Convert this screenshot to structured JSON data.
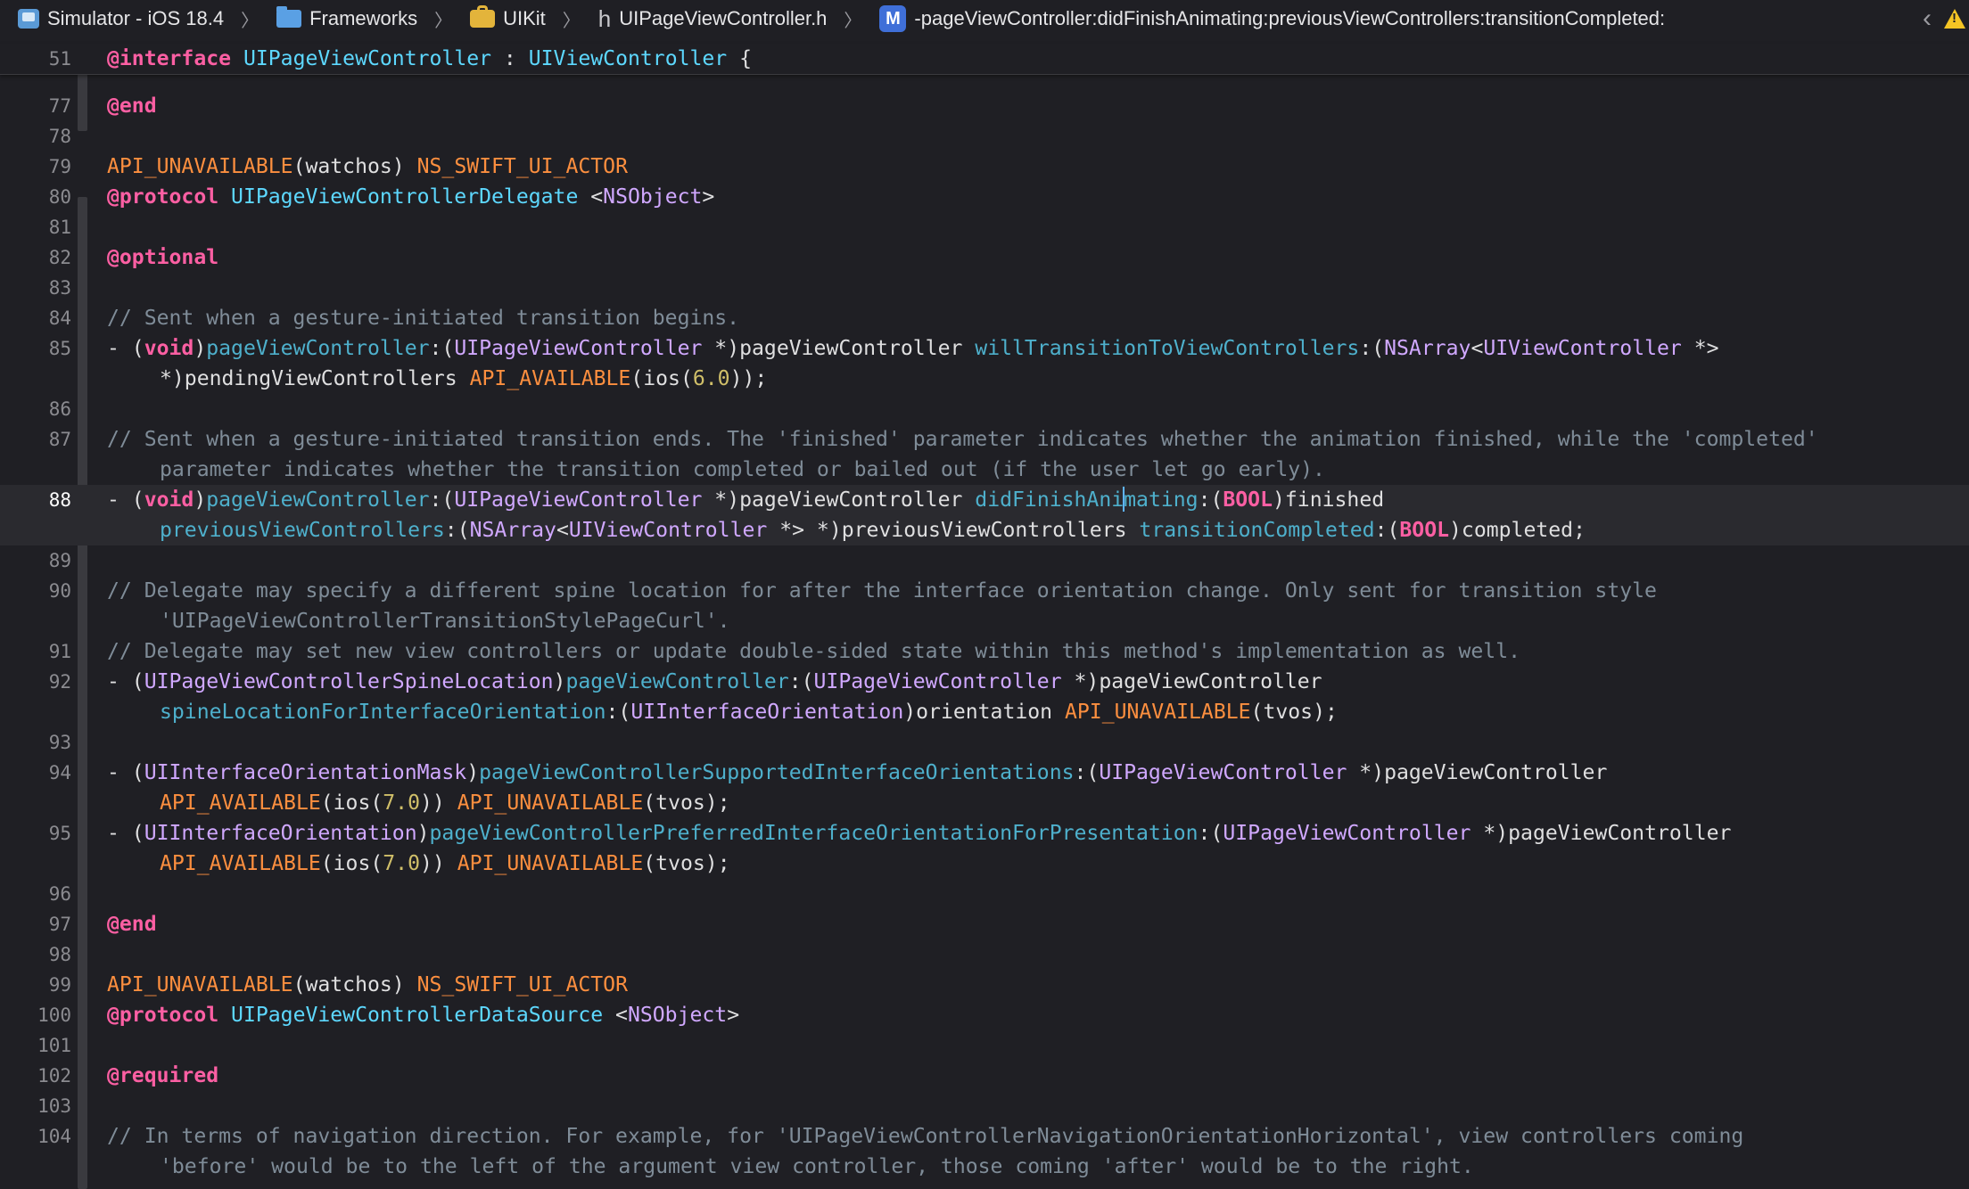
{
  "jumpbar": {
    "crumbs": [
      {
        "icon": "simulator-icon",
        "label": "Simulator - iOS 18.4"
      },
      {
        "icon": "folder-icon",
        "label": "Frameworks"
      },
      {
        "icon": "toolbox-icon",
        "label": "UIKit"
      },
      {
        "icon": "header-file-icon",
        "label": "UIPageViewController.h"
      },
      {
        "icon": "method-icon",
        "label": "-pageViewController:didFinishAnimating:previousViewControllers:transitionCompleted:"
      }
    ],
    "header_glyph": "h",
    "method_glyph": "M",
    "back_glyph": "‹",
    "warning_color": "#f5c424"
  },
  "sticky": {
    "number": "51",
    "code": "@interface UIPageViewController : UIViewController {"
  },
  "lines": [
    {
      "number": "77",
      "code": "@end"
    },
    {
      "number": "78",
      "code": ""
    },
    {
      "number": "79",
      "code": "API_UNAVAILABLE(watchos) NS_SWIFT_UI_ACTOR"
    },
    {
      "number": "80",
      "code": "@protocol UIPageViewControllerDelegate <NSObject>"
    },
    {
      "number": "81",
      "code": ""
    },
    {
      "number": "82",
      "code": "@optional"
    },
    {
      "number": "83",
      "code": ""
    },
    {
      "number": "84",
      "code": "// Sent when a gesture-initiated transition begins."
    },
    {
      "number": "85",
      "code": "- (void)pageViewController:(UIPageViewController *)pageViewController willTransitionToViewControllers:(NSArray<UIViewController *>",
      "cont": "*)pendingViewControllers API_AVAILABLE(ios(6.0));"
    },
    {
      "number": "86",
      "code": ""
    },
    {
      "number": "87",
      "code": "// Sent when a gesture-initiated transition ends. The 'finished' parameter indicates whether the animation finished, while the 'completed'",
      "cont": "parameter indicates whether the transition completed or bailed out (if the user let go early)."
    },
    {
      "number": "88",
      "code": "- (void)pageViewController:(UIPageViewController *)pageViewController didFinishAnimating:(BOOL)finished",
      "cont": "previousViewControllers:(NSArray<UIViewController *> *)previousViewControllers transitionCompleted:(BOOL)completed;",
      "current": true
    },
    {
      "number": "89",
      "code": ""
    },
    {
      "number": "90",
      "code": "// Delegate may specify a different spine location for after the interface orientation change. Only sent for transition style",
      "cont": "'UIPageViewControllerTransitionStylePageCurl'."
    },
    {
      "number": "91",
      "code": "// Delegate may set new view controllers or update double-sided state within this method's implementation as well."
    },
    {
      "number": "92",
      "code": "- (UIPageViewControllerSpineLocation)pageViewController:(UIPageViewController *)pageViewController",
      "cont": "spineLocationForInterfaceOrientation:(UIInterfaceOrientation)orientation API_UNAVAILABLE(tvos);"
    },
    {
      "number": "93",
      "code": ""
    },
    {
      "number": "94",
      "code": "- (UIInterfaceOrientationMask)pageViewControllerSupportedInterfaceOrientations:(UIPageViewController *)pageViewController",
      "cont": "API_AVAILABLE(ios(7.0)) API_UNAVAILABLE(tvos);"
    },
    {
      "number": "95",
      "code": "- (UIInterfaceOrientation)pageViewControllerPreferredInterfaceOrientationForPresentation:(UIPageViewController *)pageViewController",
      "cont": "API_AVAILABLE(ios(7.0)) API_UNAVAILABLE(tvos);"
    },
    {
      "number": "96",
      "code": ""
    },
    {
      "number": "97",
      "code": "@end"
    },
    {
      "number": "98",
      "code": ""
    },
    {
      "number": "99",
      "code": "API_UNAVAILABLE(watchos) NS_SWIFT_UI_ACTOR"
    },
    {
      "number": "100",
      "code": "@protocol UIPageViewControllerDataSource <NSObject>"
    },
    {
      "number": "101",
      "code": ""
    },
    {
      "number": "102",
      "code": "@required"
    },
    {
      "number": "103",
      "code": ""
    },
    {
      "number": "104",
      "code": "// In terms of navigation direction. For example, for 'UIPageViewControllerNavigationOrientationHorizontal', view controllers coming",
      "cont": "'before' would be to the left of the argument view controller, those coming 'after' would be to the right."
    }
  ]
}
